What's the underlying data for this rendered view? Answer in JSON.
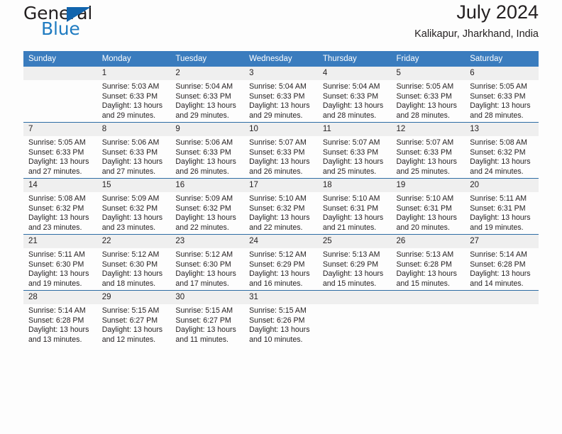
{
  "brand": {
    "name_part1": "General",
    "name_part2": "Blue",
    "logo_icon": "triangle-icon",
    "accent_color": "#1f7bc1",
    "triangle_color": "#1164ad"
  },
  "header": {
    "title": "July 2024",
    "subtitle": "Kalikapur, Jharkhand, India"
  },
  "calendar": {
    "header_bg": "#3a7cbe",
    "header_text_color": "#ffffff",
    "row_separator_color": "#2e6da4",
    "daynum_bg": "#efefef",
    "weekdays": [
      "Sunday",
      "Monday",
      "Tuesday",
      "Wednesday",
      "Thursday",
      "Friday",
      "Saturday"
    ],
    "weeks": [
      [
        {
          "day": "",
          "sunrise": "",
          "sunset": "",
          "daylight1": "",
          "daylight2": ""
        },
        {
          "day": "1",
          "sunrise": "Sunrise: 5:03 AM",
          "sunset": "Sunset: 6:33 PM",
          "daylight1": "Daylight: 13 hours",
          "daylight2": "and 29 minutes."
        },
        {
          "day": "2",
          "sunrise": "Sunrise: 5:04 AM",
          "sunset": "Sunset: 6:33 PM",
          "daylight1": "Daylight: 13 hours",
          "daylight2": "and 29 minutes."
        },
        {
          "day": "3",
          "sunrise": "Sunrise: 5:04 AM",
          "sunset": "Sunset: 6:33 PM",
          "daylight1": "Daylight: 13 hours",
          "daylight2": "and 29 minutes."
        },
        {
          "day": "4",
          "sunrise": "Sunrise: 5:04 AM",
          "sunset": "Sunset: 6:33 PM",
          "daylight1": "Daylight: 13 hours",
          "daylight2": "and 28 minutes."
        },
        {
          "day": "5",
          "sunrise": "Sunrise: 5:05 AM",
          "sunset": "Sunset: 6:33 PM",
          "daylight1": "Daylight: 13 hours",
          "daylight2": "and 28 minutes."
        },
        {
          "day": "6",
          "sunrise": "Sunrise: 5:05 AM",
          "sunset": "Sunset: 6:33 PM",
          "daylight1": "Daylight: 13 hours",
          "daylight2": "and 28 minutes."
        }
      ],
      [
        {
          "day": "7",
          "sunrise": "Sunrise: 5:05 AM",
          "sunset": "Sunset: 6:33 PM",
          "daylight1": "Daylight: 13 hours",
          "daylight2": "and 27 minutes."
        },
        {
          "day": "8",
          "sunrise": "Sunrise: 5:06 AM",
          "sunset": "Sunset: 6:33 PM",
          "daylight1": "Daylight: 13 hours",
          "daylight2": "and 27 minutes."
        },
        {
          "day": "9",
          "sunrise": "Sunrise: 5:06 AM",
          "sunset": "Sunset: 6:33 PM",
          "daylight1": "Daylight: 13 hours",
          "daylight2": "and 26 minutes."
        },
        {
          "day": "10",
          "sunrise": "Sunrise: 5:07 AM",
          "sunset": "Sunset: 6:33 PM",
          "daylight1": "Daylight: 13 hours",
          "daylight2": "and 26 minutes."
        },
        {
          "day": "11",
          "sunrise": "Sunrise: 5:07 AM",
          "sunset": "Sunset: 6:33 PM",
          "daylight1": "Daylight: 13 hours",
          "daylight2": "and 25 minutes."
        },
        {
          "day": "12",
          "sunrise": "Sunrise: 5:07 AM",
          "sunset": "Sunset: 6:33 PM",
          "daylight1": "Daylight: 13 hours",
          "daylight2": "and 25 minutes."
        },
        {
          "day": "13",
          "sunrise": "Sunrise: 5:08 AM",
          "sunset": "Sunset: 6:32 PM",
          "daylight1": "Daylight: 13 hours",
          "daylight2": "and 24 minutes."
        }
      ],
      [
        {
          "day": "14",
          "sunrise": "Sunrise: 5:08 AM",
          "sunset": "Sunset: 6:32 PM",
          "daylight1": "Daylight: 13 hours",
          "daylight2": "and 23 minutes."
        },
        {
          "day": "15",
          "sunrise": "Sunrise: 5:09 AM",
          "sunset": "Sunset: 6:32 PM",
          "daylight1": "Daylight: 13 hours",
          "daylight2": "and 23 minutes."
        },
        {
          "day": "16",
          "sunrise": "Sunrise: 5:09 AM",
          "sunset": "Sunset: 6:32 PM",
          "daylight1": "Daylight: 13 hours",
          "daylight2": "and 22 minutes."
        },
        {
          "day": "17",
          "sunrise": "Sunrise: 5:10 AM",
          "sunset": "Sunset: 6:32 PM",
          "daylight1": "Daylight: 13 hours",
          "daylight2": "and 22 minutes."
        },
        {
          "day": "18",
          "sunrise": "Sunrise: 5:10 AM",
          "sunset": "Sunset: 6:31 PM",
          "daylight1": "Daylight: 13 hours",
          "daylight2": "and 21 minutes."
        },
        {
          "day": "19",
          "sunrise": "Sunrise: 5:10 AM",
          "sunset": "Sunset: 6:31 PM",
          "daylight1": "Daylight: 13 hours",
          "daylight2": "and 20 minutes."
        },
        {
          "day": "20",
          "sunrise": "Sunrise: 5:11 AM",
          "sunset": "Sunset: 6:31 PM",
          "daylight1": "Daylight: 13 hours",
          "daylight2": "and 19 minutes."
        }
      ],
      [
        {
          "day": "21",
          "sunrise": "Sunrise: 5:11 AM",
          "sunset": "Sunset: 6:30 PM",
          "daylight1": "Daylight: 13 hours",
          "daylight2": "and 19 minutes."
        },
        {
          "day": "22",
          "sunrise": "Sunrise: 5:12 AM",
          "sunset": "Sunset: 6:30 PM",
          "daylight1": "Daylight: 13 hours",
          "daylight2": "and 18 minutes."
        },
        {
          "day": "23",
          "sunrise": "Sunrise: 5:12 AM",
          "sunset": "Sunset: 6:30 PM",
          "daylight1": "Daylight: 13 hours",
          "daylight2": "and 17 minutes."
        },
        {
          "day": "24",
          "sunrise": "Sunrise: 5:12 AM",
          "sunset": "Sunset: 6:29 PM",
          "daylight1": "Daylight: 13 hours",
          "daylight2": "and 16 minutes."
        },
        {
          "day": "25",
          "sunrise": "Sunrise: 5:13 AM",
          "sunset": "Sunset: 6:29 PM",
          "daylight1": "Daylight: 13 hours",
          "daylight2": "and 15 minutes."
        },
        {
          "day": "26",
          "sunrise": "Sunrise: 5:13 AM",
          "sunset": "Sunset: 6:28 PM",
          "daylight1": "Daylight: 13 hours",
          "daylight2": "and 15 minutes."
        },
        {
          "day": "27",
          "sunrise": "Sunrise: 5:14 AM",
          "sunset": "Sunset: 6:28 PM",
          "daylight1": "Daylight: 13 hours",
          "daylight2": "and 14 minutes."
        }
      ],
      [
        {
          "day": "28",
          "sunrise": "Sunrise: 5:14 AM",
          "sunset": "Sunset: 6:28 PM",
          "daylight1": "Daylight: 13 hours",
          "daylight2": "and 13 minutes."
        },
        {
          "day": "29",
          "sunrise": "Sunrise: 5:15 AM",
          "sunset": "Sunset: 6:27 PM",
          "daylight1": "Daylight: 13 hours",
          "daylight2": "and 12 minutes."
        },
        {
          "day": "30",
          "sunrise": "Sunrise: 5:15 AM",
          "sunset": "Sunset: 6:27 PM",
          "daylight1": "Daylight: 13 hours",
          "daylight2": "and 11 minutes."
        },
        {
          "day": "31",
          "sunrise": "Sunrise: 5:15 AM",
          "sunset": "Sunset: 6:26 PM",
          "daylight1": "Daylight: 13 hours",
          "daylight2": "and 10 minutes."
        },
        {
          "day": "",
          "sunrise": "",
          "sunset": "",
          "daylight1": "",
          "daylight2": ""
        },
        {
          "day": "",
          "sunrise": "",
          "sunset": "",
          "daylight1": "",
          "daylight2": ""
        },
        {
          "day": "",
          "sunrise": "",
          "sunset": "",
          "daylight1": "",
          "daylight2": ""
        }
      ]
    ]
  }
}
